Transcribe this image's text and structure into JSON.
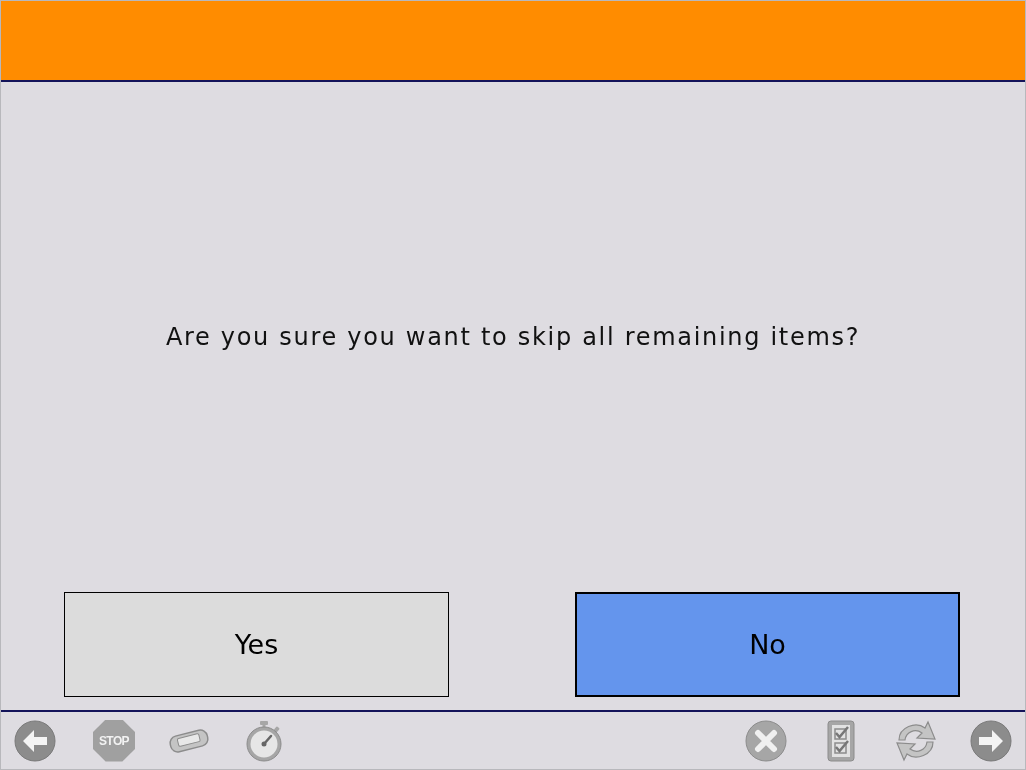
{
  "header": {
    "kind": "banner"
  },
  "message": "Are you sure you want to skip all remaining items?",
  "buttons": [
    {
      "label": "Yes",
      "selected": false
    },
    {
      "label": "No",
      "selected": true
    }
  ],
  "toolbar": {
    "left": [
      {
        "kind": "back",
        "disabled": true
      },
      {
        "kind": "stop",
        "label": "STOP",
        "disabled": true
      },
      {
        "kind": "device",
        "disabled": true
      },
      {
        "kind": "stopwatch",
        "disabled": true
      }
    ],
    "right": [
      {
        "kind": "cancel",
        "disabled": true
      },
      {
        "kind": "checklist",
        "disabled": true
      },
      {
        "kind": "refresh",
        "disabled": true
      },
      {
        "kind": "forward",
        "disabled": true
      }
    ]
  }
}
